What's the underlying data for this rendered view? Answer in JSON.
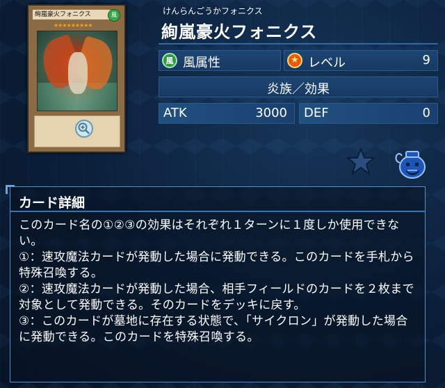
{
  "card": {
    "name": "絢嵐豪火フォニクス",
    "reading": "けんらんごうかフォニクス",
    "card_name_on_image": "絢嵐豪火フォニクス",
    "card_attribute_glyph": "風",
    "card_stars": "★★★★★★★★★"
  },
  "stats": {
    "attribute_icon_glyph": "風",
    "attribute": "風属性",
    "level_label": "レベル",
    "level_value": "9",
    "type_line": "炎族／効果",
    "atk_label": "ATK",
    "atk_value": "3000",
    "def_label": "DEF",
    "def_value": "0"
  },
  "details": {
    "heading": "カード詳細",
    "text": "このカード名の①②③の効果はそれぞれ１ターンに１度しか使用できない。\n①：速攻魔法カードが発動した場合に発動できる。このカードを手札から特殊召喚する。\n②：速攻魔法カードが発動した場合、相手フィールドのカードを２枚まで対象として発動できる。そのカードをデッキに戻す。\n③：このカードが墓地に存在する状態で、「サイクロン」が発動した場合に発動できる。このカードを特殊召喚する。"
  },
  "icons": {
    "zoom": "zoom-icon",
    "favorite": "star-icon",
    "pot": "pot-of-greed-icon"
  },
  "colors": {
    "background": "#0b1f3a",
    "panel": "#1d4472",
    "accent": "#3a72b4"
  }
}
